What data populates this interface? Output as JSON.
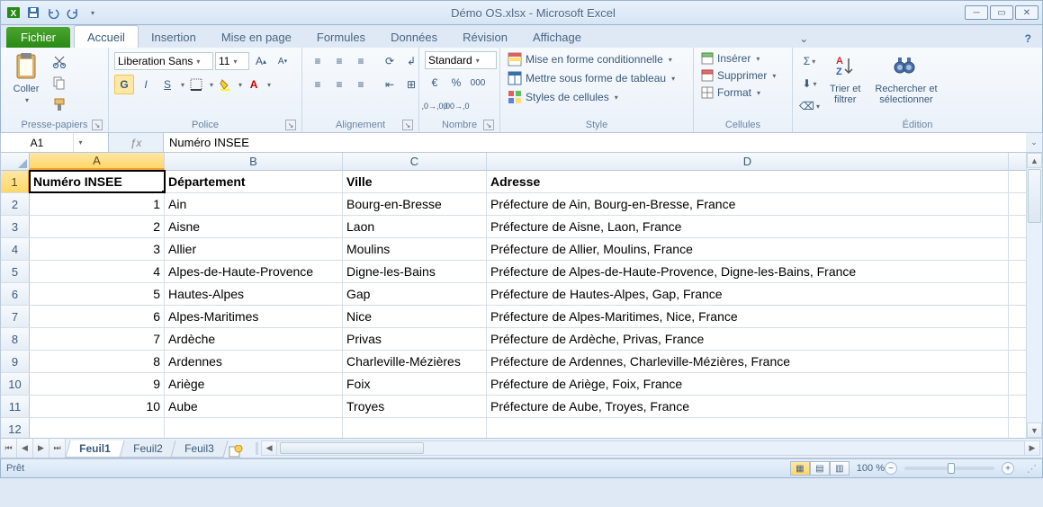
{
  "window": {
    "title": "Démo OS.xlsx - Microsoft Excel"
  },
  "tabs": {
    "file": "Fichier",
    "items": [
      "Accueil",
      "Insertion",
      "Mise en page",
      "Formules",
      "Données",
      "Révision",
      "Affichage"
    ],
    "active": 0
  },
  "ribbon": {
    "clipboard": {
      "paste": "Coller",
      "label": "Presse-papiers"
    },
    "font": {
      "name": "Liberation Sans",
      "size": "11",
      "bold": "G",
      "italic": "I",
      "underline": "S",
      "label": "Police"
    },
    "alignment": {
      "label": "Alignement"
    },
    "number": {
      "format": "Standard",
      "label": "Nombre"
    },
    "style": {
      "cond": "Mise en forme conditionnelle",
      "table": "Mettre sous forme de tableau",
      "cell": "Styles de cellules",
      "label": "Style"
    },
    "cells": {
      "insert": "Insérer",
      "delete": "Supprimer",
      "format": "Format",
      "label": "Cellules"
    },
    "editing": {
      "sort": "Trier et\nfiltrer",
      "find": "Rechercher et\nsélectionner",
      "label": "Édition"
    }
  },
  "formula_bar": {
    "name_box": "A1",
    "formula": "Numéro INSEE"
  },
  "grid": {
    "columns": [
      "A",
      "B",
      "C",
      "D"
    ],
    "headers": [
      "Numéro INSEE",
      "Département",
      "Ville",
      "Adresse"
    ],
    "rows": [
      {
        "n": "1",
        "a": "1",
        "b": "Ain",
        "c": "Bourg-en-Bresse",
        "d": "Préfecture de Ain, Bourg-en-Bresse, France"
      },
      {
        "n": "2",
        "a": "2",
        "b": "Aisne",
        "c": "Laon",
        "d": "Préfecture de Aisne, Laon, France"
      },
      {
        "n": "3",
        "a": "3",
        "b": "Allier",
        "c": "Moulins",
        "d": "Préfecture de Allier, Moulins, France"
      },
      {
        "n": "4",
        "a": "4",
        "b": "Alpes-de-Haute-Provence",
        "c": "Digne-les-Bains",
        "d": "Préfecture de Alpes-de-Haute-Provence, Digne-les-Bains, France"
      },
      {
        "n": "5",
        "a": "5",
        "b": "Hautes-Alpes",
        "c": "Gap",
        "d": "Préfecture de Hautes-Alpes, Gap, France"
      },
      {
        "n": "6",
        "a": "6",
        "b": "Alpes-Maritimes",
        "c": "Nice",
        "d": "Préfecture de Alpes-Maritimes, Nice, France"
      },
      {
        "n": "7",
        "a": "7",
        "b": "Ardèche",
        "c": "Privas",
        "d": "Préfecture de Ardèche, Privas, France"
      },
      {
        "n": "8",
        "a": "8",
        "b": "Ardennes",
        "c": "Charleville-Mézières",
        "d": "Préfecture de Ardennes, Charleville-Mézières, France"
      },
      {
        "n": "9",
        "a": "9",
        "b": "Ariège",
        "c": "Foix",
        "d": "Préfecture de Ariège, Foix, France"
      },
      {
        "n": "10",
        "a": "10",
        "b": "Aube",
        "c": "Troyes",
        "d": "Préfecture de Aube, Troyes, France"
      }
    ]
  },
  "sheets": {
    "items": [
      "Feuil1",
      "Feuil2",
      "Feuil3"
    ],
    "active": 0
  },
  "status": {
    "ready": "Prêt",
    "zoom": "100 %"
  }
}
